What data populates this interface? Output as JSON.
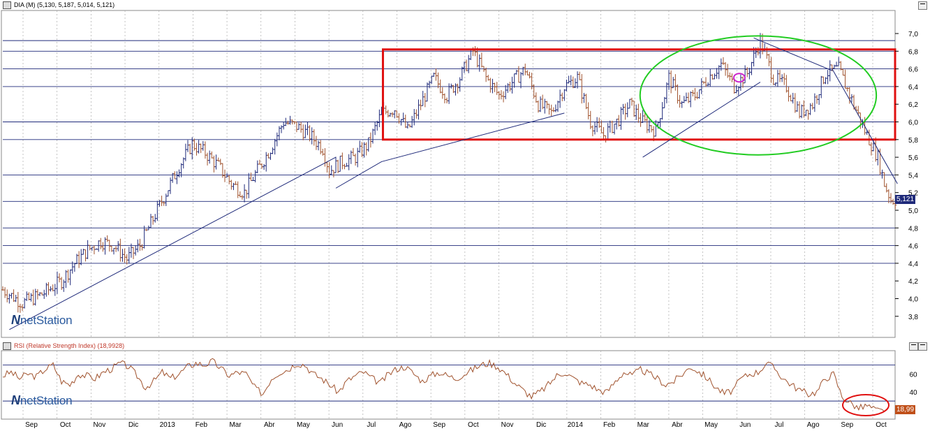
{
  "price_panel": {
    "title": "DIA (M) (5,130, 5,187, 5,014, 5,121)",
    "last_value": "5,121"
  },
  "rsi_panel": {
    "title": "RSI (Relative Strength Index) (18,9928)",
    "last_value": "18,99"
  },
  "logo": {
    "mark": "N",
    "text": "netStation"
  },
  "colors": {
    "up_bar": "#1f2a7a",
    "down_bar": "#a0522d",
    "trendline": "#1f2a7a",
    "rectangle": "#e01010",
    "ellipse": "#22cc22",
    "small_ellipse": "#cc22cc",
    "rsi_line": "#a0522d",
    "rsi_circle": "#e01010",
    "value_box": "#1f2a7a",
    "rsi_box": "#c0501a"
  },
  "chart_data": [
    {
      "type": "ohlc",
      "yaxis_ticks": [
        "7,0",
        "6,8",
        "6,6",
        "6,4",
        "6,2",
        "6,0",
        "5,8",
        "5,6",
        "5,4",
        "5,2",
        "5,0",
        "4,8",
        "4,6",
        "4,4",
        "4,2",
        "4,0",
        "3,8"
      ],
      "ylim": [
        3.6,
        7.1
      ],
      "horizontal_levels": [
        6.92,
        6.8,
        6.6,
        6.4,
        6.0,
        5.8,
        5.4,
        5.1,
        4.8,
        4.6,
        4.4
      ],
      "x_labels": [
        "Sep",
        "Oct",
        "Nov",
        "Dic",
        "2013",
        "Feb",
        "Mar",
        "Abr",
        "May",
        "Jun",
        "Jul",
        "Ago",
        "Sep",
        "Oct",
        "Nov",
        "Dic",
        "2014",
        "Feb",
        "Mar",
        "Abr",
        "May",
        "Jun",
        "Jul",
        "Ago",
        "Sep",
        "Oct"
      ],
      "close_path": [
        [
          0,
          4.1
        ],
        [
          3,
          3.95
        ],
        [
          6,
          4.05
        ],
        [
          9,
          4.2
        ],
        [
          11,
          4.4
        ],
        [
          13,
          4.55
        ],
        [
          15,
          4.65
        ],
        [
          17,
          4.6
        ],
        [
          19,
          4.45
        ],
        [
          21,
          4.6
        ],
        [
          23,
          4.9
        ],
        [
          25,
          5.2
        ],
        [
          27,
          5.5
        ],
        [
          29,
          5.75
        ],
        [
          31,
          5.65
        ],
        [
          33,
          5.5
        ],
        [
          35,
          5.3
        ],
        [
          37,
          5.2
        ],
        [
          39,
          5.45
        ],
        [
          41,
          5.7
        ],
        [
          43,
          6.0
        ],
        [
          45,
          5.95
        ],
        [
          47,
          5.85
        ],
        [
          49,
          5.7
        ],
        [
          50,
          5.45
        ],
        [
          52,
          5.55
        ],
        [
          54,
          5.6
        ],
        [
          56,
          5.75
        ],
        [
          58,
          6.1
        ],
        [
          60,
          6.15
        ],
        [
          62,
          5.9
        ],
        [
          64,
          6.2
        ],
        [
          66,
          6.5
        ],
        [
          68,
          6.3
        ],
        [
          70,
          6.5
        ],
        [
          72,
          6.8
        ],
        [
          74,
          6.5
        ],
        [
          76,
          6.3
        ],
        [
          78,
          6.45
        ],
        [
          80,
          6.6
        ],
        [
          82,
          6.2
        ],
        [
          84,
          6.1
        ],
        [
          86,
          6.4
        ],
        [
          88,
          6.5
        ],
        [
          90,
          6.0
        ],
        [
          92,
          5.85
        ],
        [
          94,
          6.0
        ],
        [
          96,
          6.2
        ],
        [
          98,
          6.0
        ],
        [
          100,
          5.9
        ],
        [
          102,
          6.5
        ],
        [
          104,
          6.2
        ],
        [
          106,
          6.3
        ],
        [
          108,
          6.5
        ],
        [
          110,
          6.65
        ],
        [
          112,
          6.4
        ],
        [
          114,
          6.55
        ],
        [
          116,
          6.92
        ],
        [
          118,
          6.5
        ],
        [
          120,
          6.4
        ],
        [
          122,
          6.1
        ],
        [
          124,
          6.2
        ],
        [
          126,
          6.55
        ],
        [
          128,
          6.6
        ],
        [
          130,
          6.25
        ],
        [
          132,
          5.9
        ],
        [
          134,
          5.6
        ],
        [
          135,
          5.3
        ],
        [
          136,
          5.12
        ]
      ],
      "annotations": {
        "rectangle": {
          "x": [
            58,
            136
          ],
          "y": [
            5.8,
            6.82
          ]
        },
        "ellipse": {
          "cx": 116,
          "cy": 6.3,
          "rx": 18,
          "ry": 0.65
        },
        "small_ellipse": {
          "cx": 113,
          "cy": 6.5
        },
        "trendlines": [
          [
            [
              1,
              3.65
            ],
            [
              51,
              5.6
            ]
          ],
          [
            [
              51,
              5.25
            ],
            [
              58,
              5.55
            ],
            [
              86,
              6.1
            ]
          ],
          [
            [
              98,
              5.6
            ],
            [
              116,
              6.45
            ]
          ],
          [
            [
              115,
              6.95
            ],
            [
              127,
              6.58
            ]
          ],
          [
            [
              127,
              6.6
            ],
            [
              137,
              5.3
            ]
          ]
        ]
      }
    },
    {
      "type": "line",
      "series": [
        {
          "name": "RSI",
          "values": [
            58,
            62,
            55,
            60,
            57,
            65,
            70,
            52,
            48,
            60,
            58,
            55,
            62,
            66,
            72,
            68,
            58,
            45,
            52,
            62,
            55,
            60,
            68,
            72,
            70,
            74,
            66,
            58,
            62,
            60,
            45,
            38,
            55,
            62,
            65,
            72,
            70,
            60,
            55,
            48,
            40,
            52,
            58,
            62,
            55,
            50,
            60,
            66,
            68,
            60,
            52,
            58,
            62,
            58,
            55,
            60,
            65,
            70,
            72,
            68,
            60,
            50,
            42,
            35,
            40,
            48,
            58,
            62,
            55,
            50,
            48,
            42,
            40,
            52,
            62,
            58,
            65,
            60,
            55,
            48,
            52,
            60,
            68,
            62,
            55,
            45,
            38,
            42,
            55,
            60,
            62,
            72,
            66,
            55,
            48,
            42,
            38,
            40,
            55,
            60,
            35,
            28,
            22,
            25,
            20,
            19
          ]
        }
      ],
      "yaxis_ticks": [
        "60",
        "40"
      ],
      "ylim": [
        10,
        85
      ],
      "reference_lines": [
        70,
        30
      ]
    }
  ]
}
